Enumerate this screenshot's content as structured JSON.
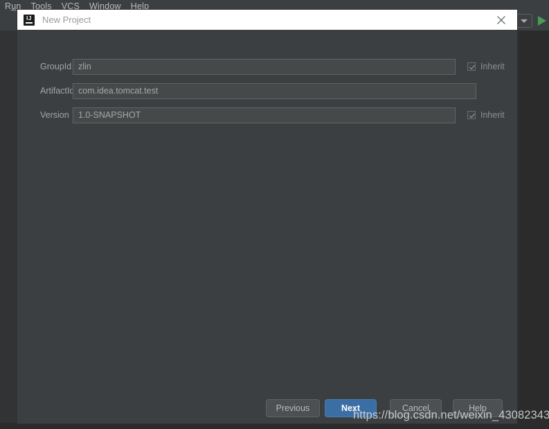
{
  "ide": {
    "menubar": [
      {
        "label": "Run",
        "mnemonic_index": 1
      },
      {
        "label": "Tools",
        "mnemonic_index": 0
      },
      {
        "label": "VCS",
        "mnemonic_index": 2
      },
      {
        "label": "Window",
        "mnemonic_index": 0
      },
      {
        "label": "Help",
        "mnemonic_index": 0
      }
    ],
    "toolbar": {
      "run_config_icon": "chevron-down-icon",
      "run_icon": "play-icon"
    },
    "colors": {
      "background": "#2b2b2b",
      "panel": "#3c3f41",
      "accent_blue": "#3b6ea5",
      "run_green": "#499c54",
      "titlebar": "#ffffff"
    }
  },
  "dialog": {
    "title": "New Project",
    "app_icon": "intellij-idea-icon",
    "app_icon_text": "IJ",
    "close_icon": "close-icon",
    "fields": [
      {
        "label": "GroupId",
        "value": "zlin",
        "placeholder": "",
        "inherit": {
          "label": "Inherit",
          "checked": true,
          "enabled": false
        }
      },
      {
        "label": "ArtifactId",
        "value": "com.idea.tomcat.test",
        "placeholder": "",
        "inherit": null
      },
      {
        "label": "Version",
        "value": "1.0-SNAPSHOT",
        "placeholder": "",
        "inherit": {
          "label": "Inherit",
          "checked": true,
          "enabled": false
        }
      }
    ],
    "buttons": {
      "previous": "Previous",
      "next": "Next",
      "cancel": "Cancel",
      "help": "Help"
    }
  },
  "watermark": {
    "text": "https://blog.csdn.net/weixin_43082343"
  }
}
